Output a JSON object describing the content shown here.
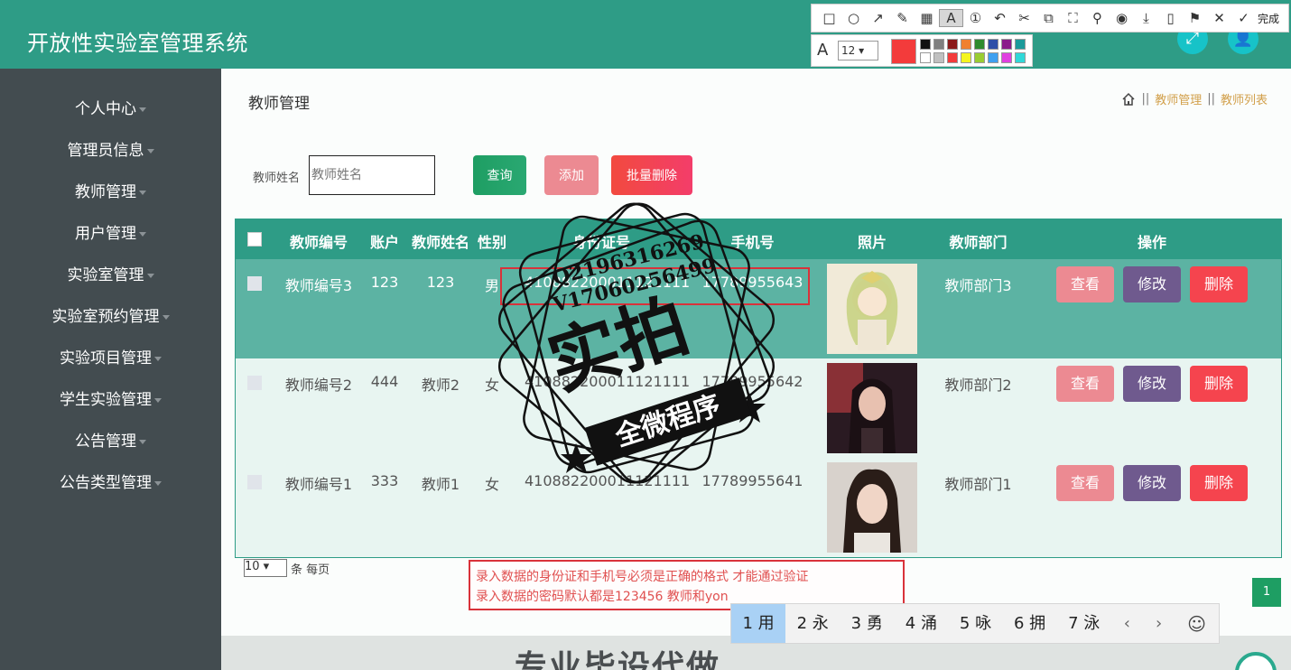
{
  "app": {
    "title": "开放性实验室管理系统"
  },
  "header": {
    "btn_fullscreen": "⤢",
    "btn_user": "👤"
  },
  "sidebar": {
    "items": [
      {
        "label": "个人中心"
      },
      {
        "label": "管理员信息"
      },
      {
        "label": "教师管理"
      },
      {
        "label": "用户管理"
      },
      {
        "label": "实验室管理"
      },
      {
        "label": "实验室预约管理"
      },
      {
        "label": "实验项目管理"
      },
      {
        "label": "学生实验管理"
      },
      {
        "label": "公告管理"
      },
      {
        "label": "公告类型管理"
      }
    ]
  },
  "page": {
    "title": "教师管理",
    "breadcrumb": {
      "sep": "||",
      "level1": "教师管理",
      "level2": "教师列表"
    }
  },
  "search": {
    "label": "教师姓名",
    "placeholder": "教师姓名",
    "query_btn": "查询",
    "add_btn": "添加",
    "batch_delete_btn": "批量删除"
  },
  "table": {
    "headers": [
      "教师编号",
      "账户",
      "教师姓名",
      "性别",
      "身份证号",
      "手机号",
      "照片",
      "教师部门",
      "操作"
    ],
    "rows": [
      {
        "id": "教师编号3",
        "account": "123",
        "name": "123",
        "gender": "男",
        "id_card": "410882200011121111",
        "phone": "17789955643",
        "dept": "教师部门3",
        "view": "查看",
        "edit": "修改",
        "delete": "删除"
      },
      {
        "id": "教师编号2",
        "account": "444",
        "name": "教师2",
        "gender": "女",
        "id_card": "410882200011121111",
        "phone": "17789955642",
        "dept": "教师部门2",
        "view": "查看",
        "edit": "修改",
        "delete": "删除"
      },
      {
        "id": "教师编号1",
        "account": "333",
        "name": "教师1",
        "gender": "女",
        "id_card": "410882200011121111",
        "phone": "17789955641",
        "dept": "教师部门1",
        "view": "查看",
        "edit": "修改",
        "delete": "删除"
      }
    ]
  },
  "pager": {
    "page_size": "10",
    "per_page_text": "条 每页",
    "current_page": "1"
  },
  "note": {
    "line1": "录入数据的身份证和手机号必须是正确的格式 才能通过验证",
    "line2": "录入数据的密码默认都是123456 教师和yon"
  },
  "ime": {
    "candidates": [
      "1 用",
      "2 永",
      "3 勇",
      "4 涌",
      "5 咏",
      "6 拥",
      "7 泳"
    ],
    "prev": "‹",
    "next": "›",
    "emoji": "☺"
  },
  "screenshot_tool": {
    "done_label": "完成",
    "font_size": "12",
    "font_icon": "A",
    "current_color": "#f33b3b",
    "palette": [
      "#111111",
      "#808080",
      "#8b1a1a",
      "#f08030",
      "#2e8b2e",
      "#2e4fa8",
      "#8b1a8b",
      "#1b9a9a",
      "#ffffff",
      "#c0c0c0",
      "#f33b3b",
      "#f5f520",
      "#9acd32",
      "#3fa0f0",
      "#e040e0",
      "#30d8d8"
    ]
  },
  "watermark": {
    "qq": "Q2196316269",
    "wx": "V17060256499",
    "main": "实拍",
    "banner": "全微程序"
  },
  "footer": {
    "text": "专业毕设代做"
  },
  "colors": {
    "primary": "#2e9c86",
    "sidebar": "#434c50",
    "accent_red": "#f5444e",
    "view_pink": "#ec8a92",
    "edit_purple": "#6f5a8e"
  }
}
